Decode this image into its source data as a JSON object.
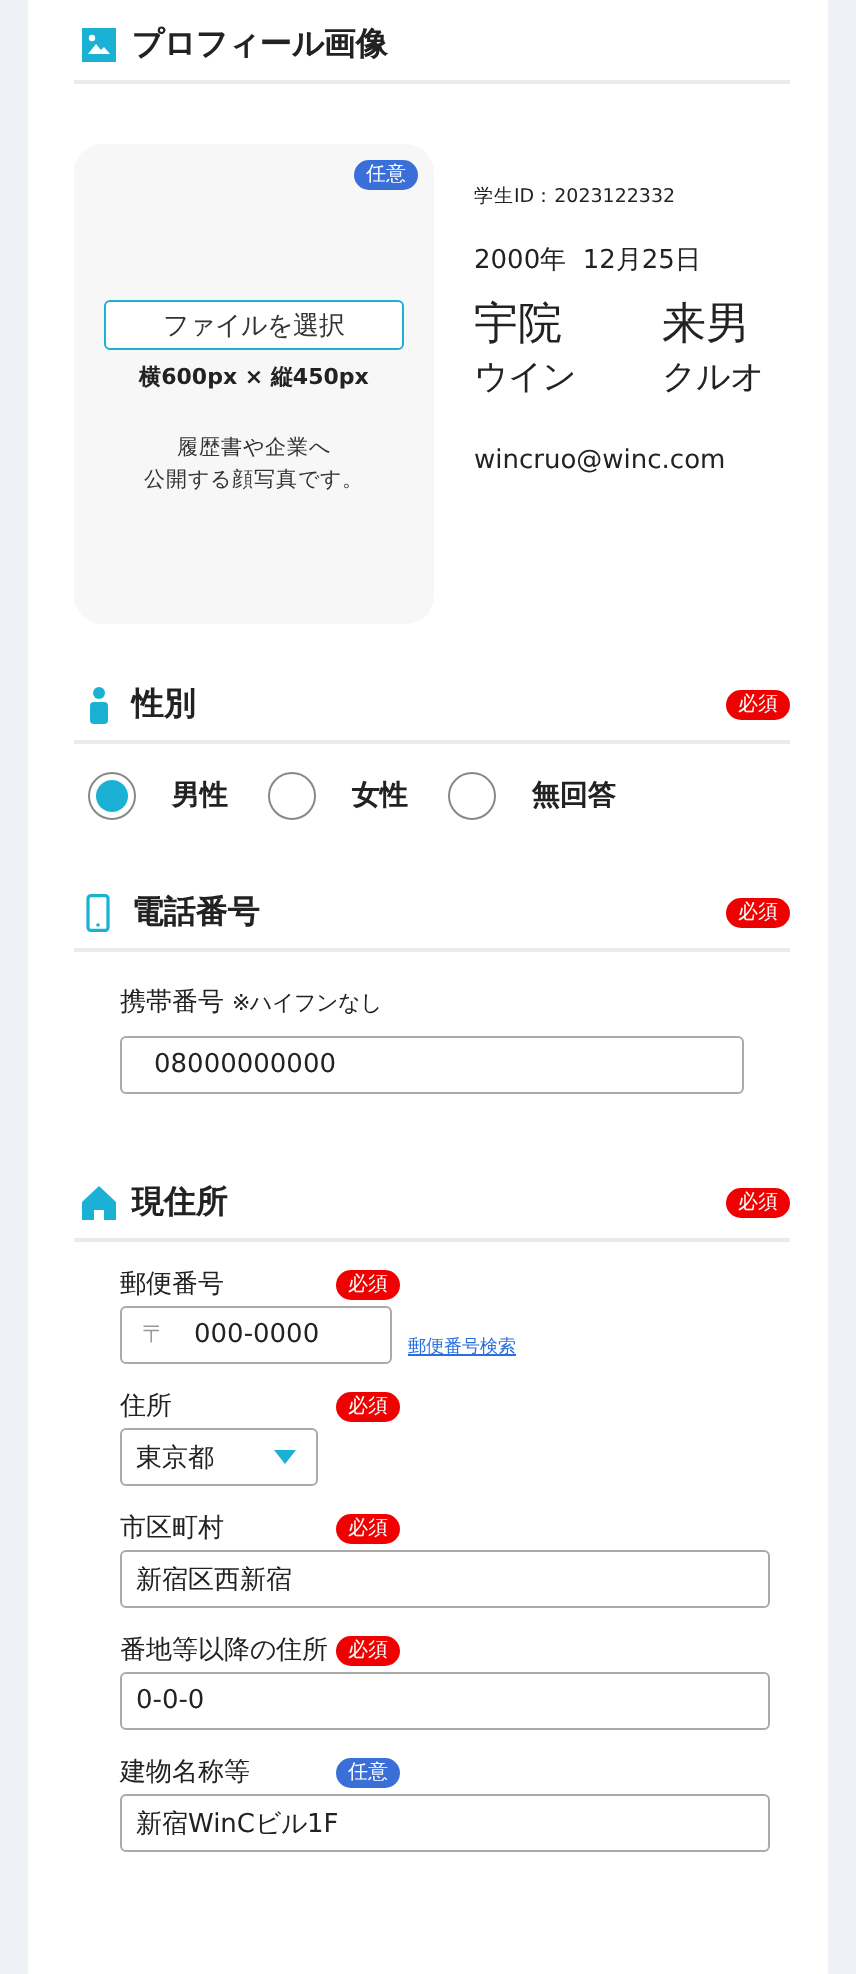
{
  "profile": {
    "title": "プロフィール画像",
    "badge": {
      "kind": "optional",
      "text": "任意"
    },
    "choose_button": "ファイルを選択",
    "size_note": "横600px × 縦450px",
    "description": [
      "履歴書や企業へ",
      "公開する顔写真です。"
    ],
    "student_id": "学生ID：2023122332",
    "birthday": "2000年  12月25日",
    "last_name": "宇院",
    "first_name": "来男",
    "last_name_kana": "ウイン",
    "first_name_kana": "クルオ",
    "email": "wincruo@winc.com"
  },
  "gender": {
    "title": "性別",
    "badge": {
      "kind": "required",
      "text": "必須"
    },
    "options": [
      {
        "label": "男性",
        "selected": true
      },
      {
        "label": "女性",
        "selected": false
      },
      {
        "label": "無回答",
        "selected": false
      }
    ]
  },
  "phone": {
    "title": "電話番号",
    "badge": {
      "kind": "required",
      "text": "必須"
    },
    "label": "携帯番号",
    "note": "※ハイフンなし",
    "value": "08000000000"
  },
  "address": {
    "title": "現住所",
    "badge": {
      "kind": "required",
      "text": "必須"
    },
    "fields": [
      {
        "kind": "postal",
        "label": "郵便番号",
        "badge": {
          "kind": "required",
          "text": "必須"
        },
        "prefix": "〒",
        "value": "000-0000",
        "link": "郵便番号検索"
      },
      {
        "kind": "select",
        "label": "住所",
        "badge": {
          "kind": "required",
          "text": "必須"
        },
        "value": "東京都"
      },
      {
        "kind": "text",
        "label": "市区町村",
        "badge": {
          "kind": "required",
          "text": "必須"
        },
        "value": "新宿区西新宿"
      },
      {
        "kind": "text",
        "label": "番地等以降の住所",
        "badge": {
          "kind": "required",
          "text": "必須"
        },
        "value": "0-0-0"
      },
      {
        "kind": "text",
        "label": "建物名称等",
        "badge": {
          "kind": "optional",
          "text": "任意"
        },
        "value": "新宿WinCビル1F"
      }
    ]
  }
}
